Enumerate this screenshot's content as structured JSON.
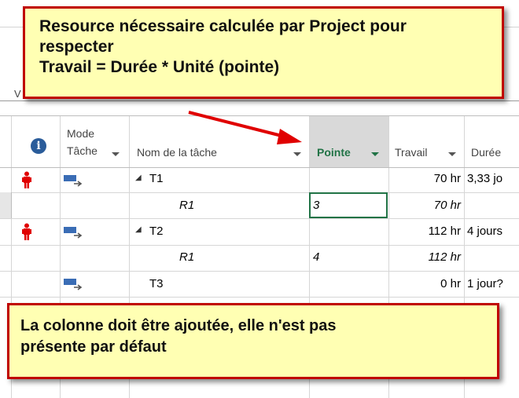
{
  "top_callout": {
    "lines": [
      "Resource nécessaire calculée par Project pour",
      "respecter",
      "Travail = Durée * Unité (pointe)"
    ]
  },
  "bottom_callout": {
    "lines": [
      "La colonne doit être ajoutée, elle n'est pas",
      "présente par défaut"
    ]
  },
  "left_fragment": "V",
  "columns": {
    "info_icon_glyph": "i",
    "mode_line1": "Mode",
    "mode_line2": "Tâche",
    "name": "Nom de la tâche",
    "pointe": "Pointe",
    "travail": "Travail",
    "duree": "Durée"
  },
  "rows": [
    {
      "indicator": "resource-overallocated",
      "mode": "auto-scheduled",
      "outline": "◢",
      "name": "T1",
      "pointe": "",
      "travail": "70 hr",
      "duree": "3,33 jo",
      "italic": false
    },
    {
      "indicator": "",
      "mode": "",
      "outline": "",
      "name": "R1",
      "pointe": "3",
      "travail": "70 hr",
      "duree": "",
      "italic": true
    },
    {
      "indicator": "resource-overallocated",
      "mode": "auto-scheduled",
      "outline": "◢",
      "name": "T2",
      "pointe": "",
      "travail": "112 hr",
      "duree": "4 jours",
      "italic": false
    },
    {
      "indicator": "",
      "mode": "",
      "outline": "",
      "name": "R1",
      "pointe": "4",
      "travail": "112 hr",
      "duree": "",
      "italic": true
    },
    {
      "indicator": "",
      "mode": "auto-scheduled",
      "outline": "",
      "name": "T3",
      "pointe": "",
      "travail": "0 hr",
      "duree": "1 jour?",
      "italic": false
    }
  ],
  "colors": {
    "callout_border": "#c00000",
    "callout_fill": "#ffffb3",
    "pointe_header_bg": "#d9d9d9",
    "pointe_header_text": "#217346",
    "selection_border": "#217346",
    "overallocated": "#e00000",
    "task_icon": "#3a6db5"
  }
}
